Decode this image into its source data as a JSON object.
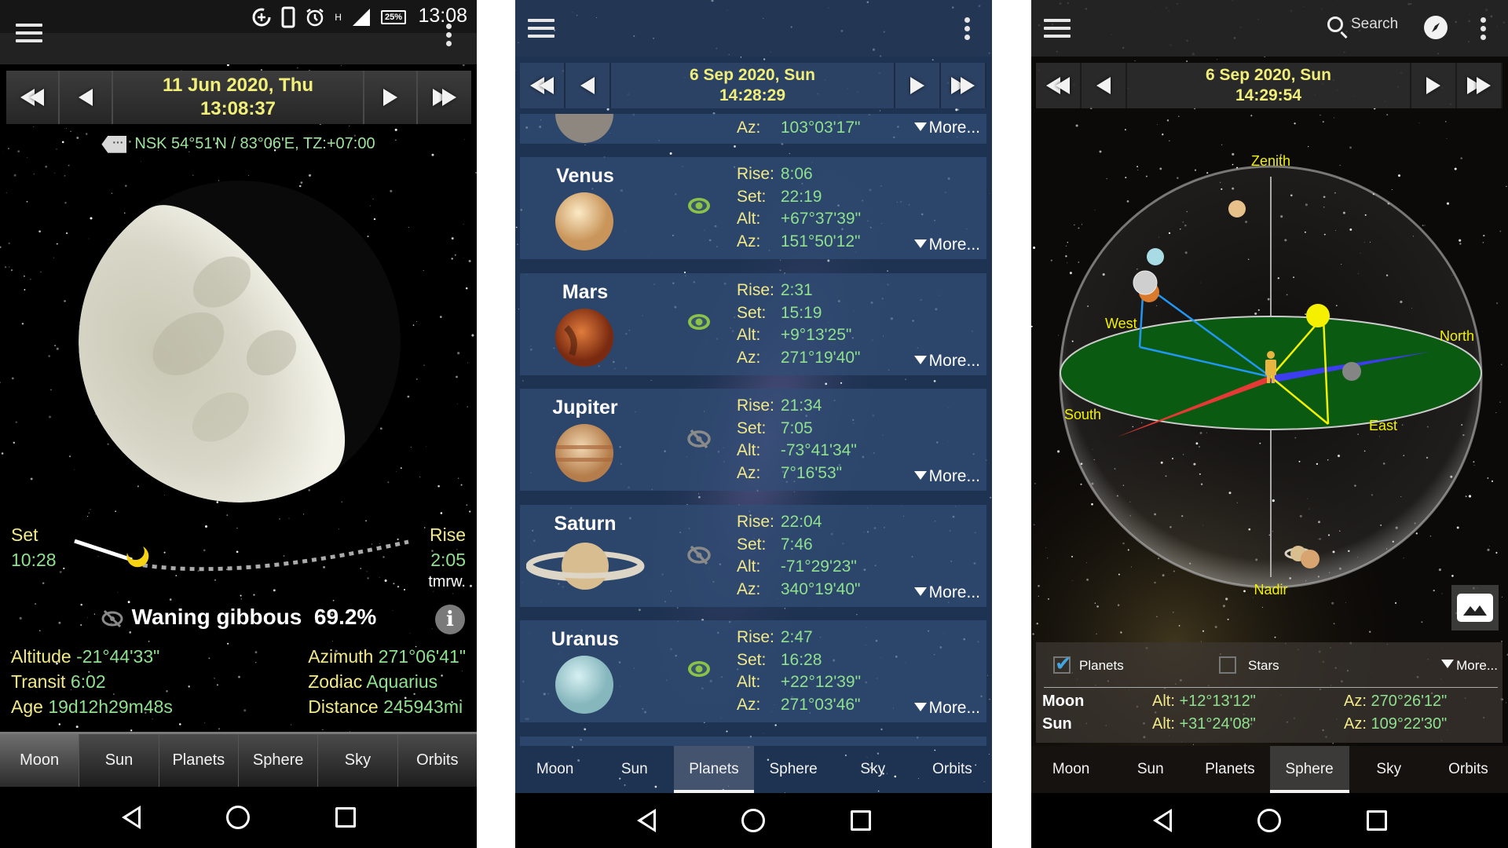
{
  "colors": {
    "date_text": "#f1ef7a",
    "label_yellow": "#f2e98a",
    "value_green": "#8fe08f",
    "visible_eye": "#8bc34a",
    "hidden_eye": "#8a8a8a",
    "checkbox_accent": "#41a5e0",
    "sphere_horizon": "#0b5a12",
    "sphere_label": "#f2f200"
  },
  "moon_screen": {
    "status_bar": {
      "time": "13:08",
      "battery": "25%",
      "network": "H"
    },
    "date_nav": {
      "date": "11 Jun 2020,  Thu",
      "time": "13:08:37"
    },
    "location": "NSK  54°51'N  /  83°06'E, TZ:+07:00",
    "set": {
      "label": "Set",
      "time": "10:28"
    },
    "rise": {
      "label": "Rise",
      "time": "2:05",
      "note": "tmrw."
    },
    "phase": {
      "name": "Waning gibbous",
      "illumination": "69.2%"
    },
    "illuminated_fraction": 0.692,
    "info_left": [
      {
        "label": "Altitude",
        "value": "-21°44'33\""
      },
      {
        "label": "Transit",
        "value": "6:02"
      },
      {
        "label": "Age",
        "value": "19d12h29m48s"
      }
    ],
    "info_right": [
      {
        "label": "Azimuth",
        "value": "271°06'41\""
      },
      {
        "label": "Zodiac",
        "value": "Aquarius"
      },
      {
        "label": "Distance",
        "value": "245943mi"
      }
    ],
    "tabs": [
      "Moon",
      "Sun",
      "Planets",
      "Sphere",
      "Sky",
      "Orbits"
    ],
    "selected_tab": "Moon"
  },
  "planets_screen": {
    "date_nav": {
      "date": "6 Sep 2020,  Sun",
      "time": "14:28:29"
    },
    "partial_item": {
      "az_label": "Az:",
      "az": "103°03'17\"",
      "more": "More..."
    },
    "planets": [
      {
        "name": "Venus",
        "visible": true,
        "rise": "8:06",
        "set": "22:19",
        "alt": "+67°37'39\"",
        "az": "151°50'12\"",
        "more": "More..."
      },
      {
        "name": "Mars",
        "visible": true,
        "rise": "2:31",
        "set": "15:19",
        "alt": "+9°13'25\"",
        "az": "271°19'40\"",
        "more": "More..."
      },
      {
        "name": "Jupiter",
        "visible": false,
        "rise": "21:34",
        "set": "7:05",
        "alt": "-73°41'34\"",
        "az": "7°16'53\"",
        "more": "More..."
      },
      {
        "name": "Saturn",
        "visible": false,
        "rise": "22:04",
        "set": "7:46",
        "alt": "-71°29'23\"",
        "az": "340°19'40\"",
        "more": "More..."
      },
      {
        "name": "Uranus",
        "visible": true,
        "rise": "2:47",
        "set": "16:28",
        "alt": "+22°12'39\"",
        "az": "271°03'46\"",
        "more": "More..."
      }
    ],
    "field_labels": {
      "rise": "Rise:",
      "set": "Set:",
      "alt": "Alt:",
      "az": "Az:"
    },
    "tabs": [
      "Moon",
      "Sun",
      "Planets",
      "Sphere",
      "Sky",
      "Orbits"
    ],
    "selected_tab": "Planets"
  },
  "sphere_screen": {
    "toolbar": {
      "search_label": "Search"
    },
    "date_nav": {
      "date": "6 Sep 2020,  Sun",
      "time": "14:29:54"
    },
    "labels": {
      "zenith": "Zenith",
      "nadir": "Nadir",
      "north": "North",
      "south": "South",
      "east": "East",
      "west": "West"
    },
    "options": {
      "planets": {
        "label": "Planets",
        "checked": true
      },
      "stars": {
        "label": "Stars",
        "checked": false
      },
      "more": "More..."
    },
    "objects": [
      {
        "name": "Moon",
        "alt": "+12°13'12\"",
        "az": "270°26'12\""
      },
      {
        "name": "Sun",
        "alt": "+31°24'08\"",
        "az": "109°22'30\""
      }
    ],
    "alt_label": "Alt:",
    "az_label": "Az:",
    "tabs": [
      "Moon",
      "Sun",
      "Planets",
      "Sphere",
      "Sky",
      "Orbits"
    ],
    "selected_tab": "Sphere"
  }
}
